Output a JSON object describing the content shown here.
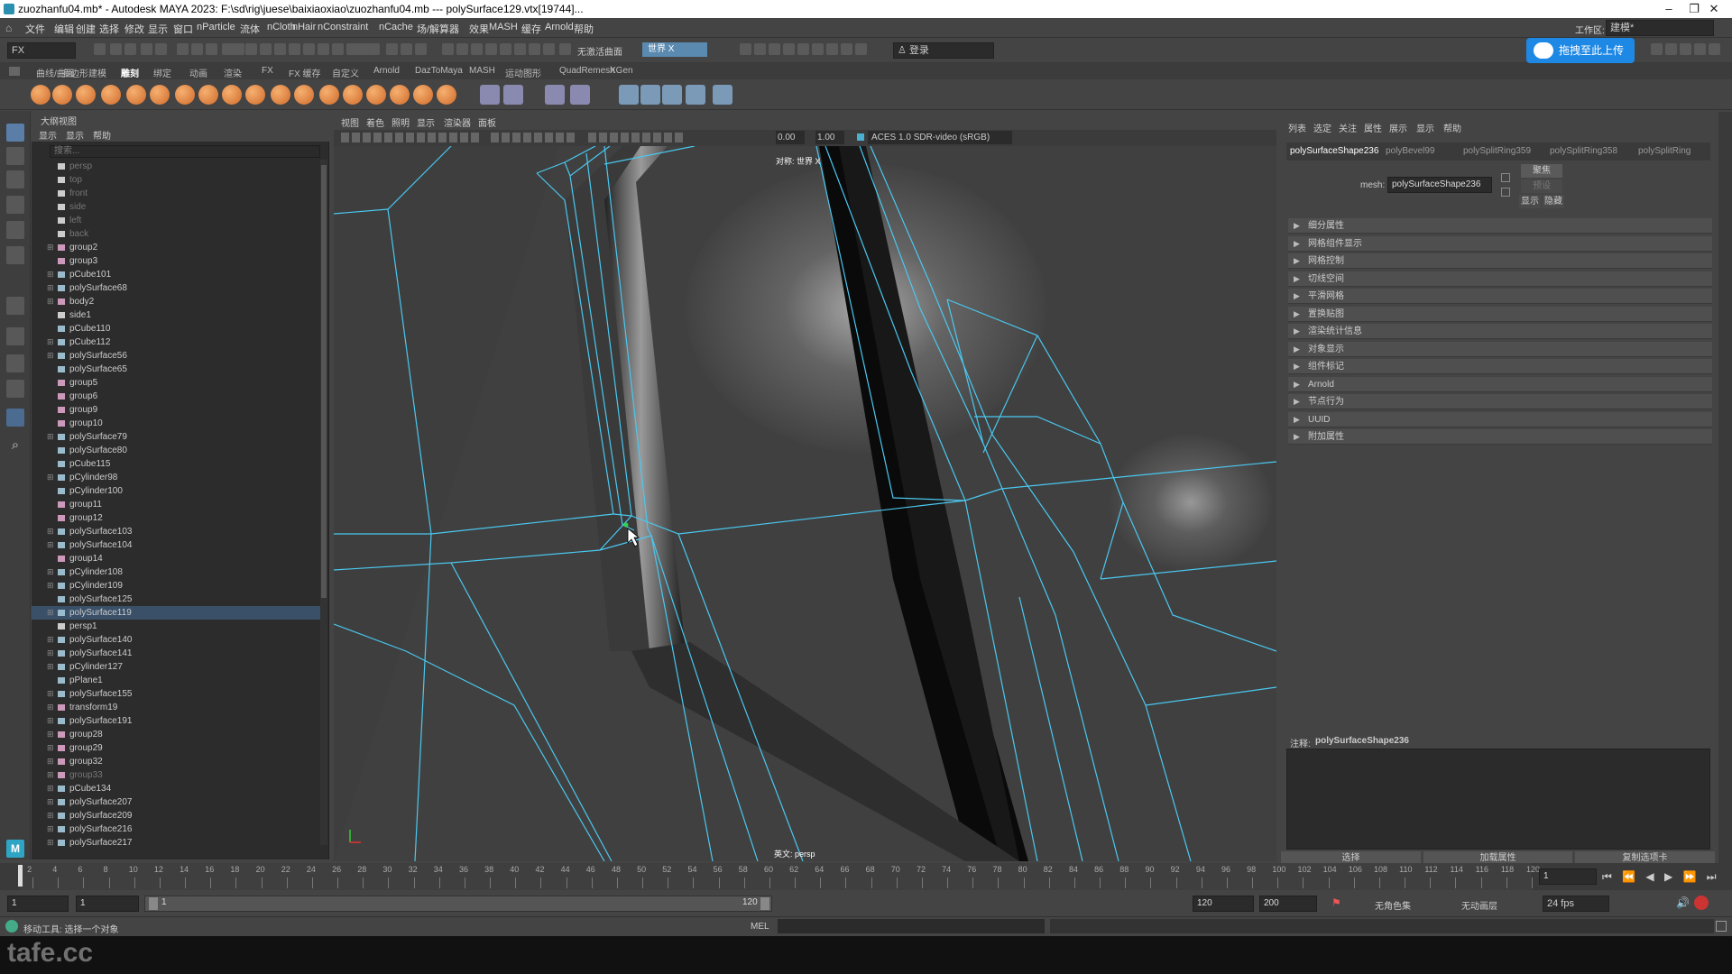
{
  "window": {
    "title": "zuozhanfu04.mb* - Autodesk MAYA 2023: F:\\sd\\rig\\juese\\baixiaoxiao\\zuozhanfu04.mb   ---   polySurface129.vtx[19744]...",
    "minimize": "–",
    "restore": "❐",
    "close": "✕"
  },
  "menubar": {
    "items": [
      "文件",
      "编辑",
      "创建",
      "选择",
      "修改",
      "显示",
      "窗口",
      "nParticle",
      "流体",
      "nCloth",
      "nHair",
      "nConstraint",
      "nCache",
      "场/解算器",
      "效果",
      "MASH",
      "缓存",
      "Arnold",
      "帮助"
    ],
    "workspace_label": "工作区:",
    "workspace_value": "建模*"
  },
  "toolbar": {
    "mode": "FX",
    "live_surface": "无激活曲面",
    "symmetry": "世界 X",
    "login": "登录",
    "upload": "拖拽至此上传"
  },
  "shelf": {
    "tabs": [
      "曲线/曲面",
      "多边形建模",
      "雕刻",
      "绑定",
      "动画",
      "渲染",
      "FX",
      "FX 缓存",
      "自定义",
      "Arnold",
      "DazToMaya",
      "MASH",
      "运动图形",
      "QuadRemesh",
      "XGen"
    ],
    "active_tab": "雕刻"
  },
  "outliner": {
    "panel_title": "大纲视图",
    "menus": [
      "显示",
      "显示",
      "帮助"
    ],
    "search_placeholder": "搜索...",
    "rows": [
      {
        "name": "persp",
        "type": "cam",
        "dim": true
      },
      {
        "name": "top",
        "type": "cam",
        "dim": true
      },
      {
        "name": "front",
        "type": "cam",
        "dim": true
      },
      {
        "name": "side",
        "type": "cam",
        "dim": true
      },
      {
        "name": "left",
        "type": "cam",
        "dim": true
      },
      {
        "name": "back",
        "type": "cam",
        "dim": true
      },
      {
        "name": "group2",
        "type": "grp",
        "exp": true
      },
      {
        "name": "group3",
        "type": "grp"
      },
      {
        "name": "pCube101",
        "type": "mesh",
        "exp": true
      },
      {
        "name": "polySurface68",
        "type": "mesh",
        "exp": true
      },
      {
        "name": "body2",
        "type": "grp",
        "exp": true
      },
      {
        "name": "side1",
        "type": "cam"
      },
      {
        "name": "pCube110",
        "type": "mesh"
      },
      {
        "name": "pCube112",
        "type": "mesh",
        "exp": true
      },
      {
        "name": "polySurface56",
        "type": "mesh",
        "exp": true
      },
      {
        "name": "polySurface65",
        "type": "mesh"
      },
      {
        "name": "group5",
        "type": "grp"
      },
      {
        "name": "group6",
        "type": "grp"
      },
      {
        "name": "group9",
        "type": "grp"
      },
      {
        "name": "group10",
        "type": "grp"
      },
      {
        "name": "polySurface79",
        "type": "mesh",
        "exp": true
      },
      {
        "name": "polySurface80",
        "type": "mesh"
      },
      {
        "name": "pCube115",
        "type": "mesh"
      },
      {
        "name": "pCylinder98",
        "type": "mesh",
        "exp": true
      },
      {
        "name": "pCylinder100",
        "type": "mesh"
      },
      {
        "name": "group11",
        "type": "grp"
      },
      {
        "name": "group12",
        "type": "grp"
      },
      {
        "name": "polySurface103",
        "type": "mesh",
        "exp": true
      },
      {
        "name": "polySurface104",
        "type": "mesh",
        "exp": true
      },
      {
        "name": "group14",
        "type": "grp"
      },
      {
        "name": "pCylinder108",
        "type": "mesh",
        "exp": true
      },
      {
        "name": "pCylinder109",
        "type": "mesh",
        "exp": true
      },
      {
        "name": "polySurface125",
        "type": "mesh"
      },
      {
        "name": "polySurface119",
        "type": "mesh",
        "exp": true,
        "sel": true
      },
      {
        "name": "persp1",
        "type": "cam"
      },
      {
        "name": "polySurface140",
        "type": "mesh",
        "exp": true
      },
      {
        "name": "polySurface141",
        "type": "mesh",
        "exp": true
      },
      {
        "name": "pCylinder127",
        "type": "mesh",
        "exp": true
      },
      {
        "name": "pPlane1",
        "type": "mesh"
      },
      {
        "name": "polySurface155",
        "type": "mesh",
        "exp": true
      },
      {
        "name": "transform19",
        "type": "grp",
        "exp": true
      },
      {
        "name": "polySurface191",
        "type": "mesh",
        "exp": true
      },
      {
        "name": "group28",
        "type": "grp",
        "exp": true
      },
      {
        "name": "group29",
        "type": "grp",
        "exp": true
      },
      {
        "name": "group32",
        "type": "grp",
        "exp": true
      },
      {
        "name": "group33",
        "type": "grp",
        "exp": true,
        "dim": true
      },
      {
        "name": "pCube134",
        "type": "mesh",
        "exp": true
      },
      {
        "name": "polySurface207",
        "type": "mesh",
        "exp": true
      },
      {
        "name": "polySurface209",
        "type": "mesh",
        "exp": true
      },
      {
        "name": "polySurface216",
        "type": "mesh",
        "exp": true
      },
      {
        "name": "polySurface217",
        "type": "mesh",
        "exp": true
      }
    ]
  },
  "viewport": {
    "menus": [
      "视图",
      "着色",
      "照明",
      "显示",
      "渲染器",
      "面板"
    ],
    "exposure": "0.00",
    "gamma": "1.00",
    "color_space": "ACES 1.0 SDR-video (sRGB)",
    "symmetry_label": "对称: 世界 X",
    "camera_label": "英文: persp"
  },
  "attribute_editor": {
    "menus": [
      "列表",
      "选定",
      "关注",
      "属性",
      "展示",
      "显示",
      "帮助"
    ],
    "tabs": [
      "polySurfaceShape236",
      "polyBevel99",
      "polySplitRing359",
      "polySplitRing358",
      "polySplitRing"
    ],
    "mesh_label": "mesh:",
    "mesh_value": "polySurfaceShape236",
    "focus_btn": "聚焦",
    "preset_btn": "预设",
    "show_btn": "显示",
    "hide_btn": "隐藏",
    "sections": [
      "细分属性",
      "网格组件显示",
      "网格控制",
      "切线空间",
      "平滑网格",
      "置换贴图",
      "渲染统计信息",
      "对象显示",
      "组件标记",
      "Arnold",
      "节点行为",
      "UUID",
      "附加属性"
    ],
    "notes_label": "注释:",
    "notes_value": "polySurfaceShape236",
    "bottom_buttons": [
      "选择",
      "加载属性",
      "复制选项卡"
    ]
  },
  "timeline": {
    "ticks": [
      2,
      4,
      6,
      8,
      10,
      12,
      14,
      16,
      18,
      20,
      22,
      24,
      26,
      28,
      30,
      32,
      34,
      36,
      38,
      40,
      42,
      44,
      46,
      48,
      50,
      52,
      54,
      56,
      58,
      60,
      62,
      64,
      66,
      68,
      70,
      72,
      74,
      76,
      78,
      80,
      82,
      84,
      86,
      88,
      90,
      92,
      94,
      96,
      98,
      100,
      102,
      104,
      106,
      108,
      110,
      112,
      114,
      116,
      118,
      120
    ],
    "current_frame": "1",
    "start": "1",
    "playback_start": "1",
    "range_start_label": "1",
    "range_end_label": "120",
    "playback_end": "120",
    "anim_end": "200",
    "char_set": "无角色集",
    "anim_layer": "无动画层",
    "fps": "24 fps"
  },
  "commandline": {
    "language": "MEL"
  },
  "status": {
    "help_text": "移动工具: 选择一个对象",
    "watermark": "tafe.cc"
  },
  "colors": {
    "wire": "#4ac8f0",
    "accent_upload": "#1e88e5"
  }
}
